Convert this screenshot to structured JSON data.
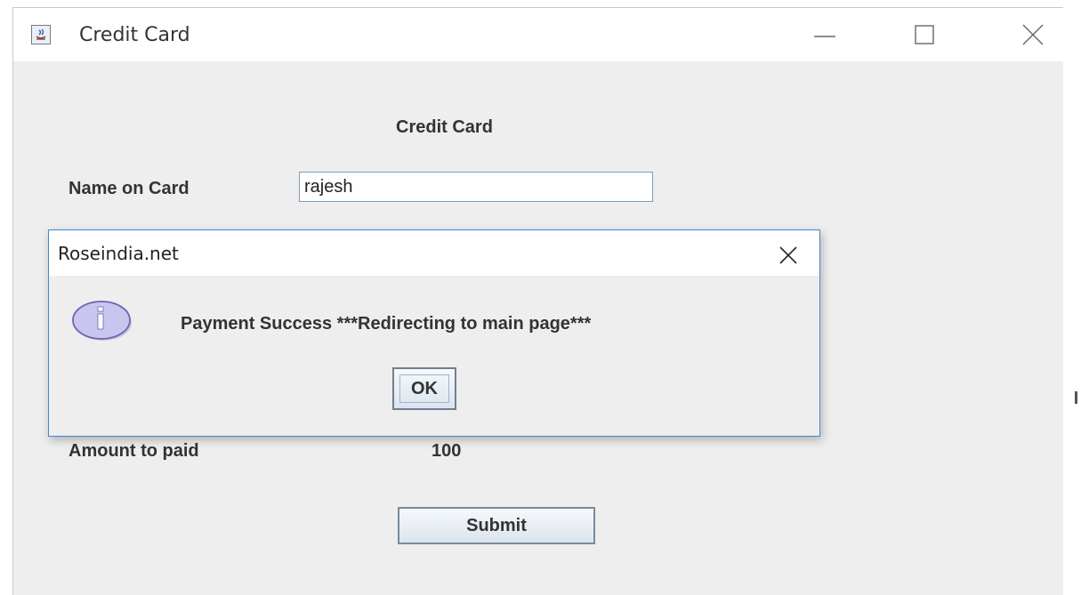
{
  "window": {
    "title": "Credit Card",
    "icon": "java-cup-icon"
  },
  "form": {
    "heading": "Credit Card",
    "name_label": "Name on Card",
    "name_value": "rajesh",
    "amount_label": "Amount to paid",
    "amount_value": "100",
    "submit_label": "Submit"
  },
  "dialog": {
    "title": "Roseindia.net",
    "message": "Payment Success ***Redirecting to main page***",
    "ok_label": "OK",
    "icon": "info-icon"
  },
  "colors": {
    "dialog_border": "#3f88d0",
    "window_background": "#eeeeee",
    "info_icon": "#b8b3e6"
  }
}
